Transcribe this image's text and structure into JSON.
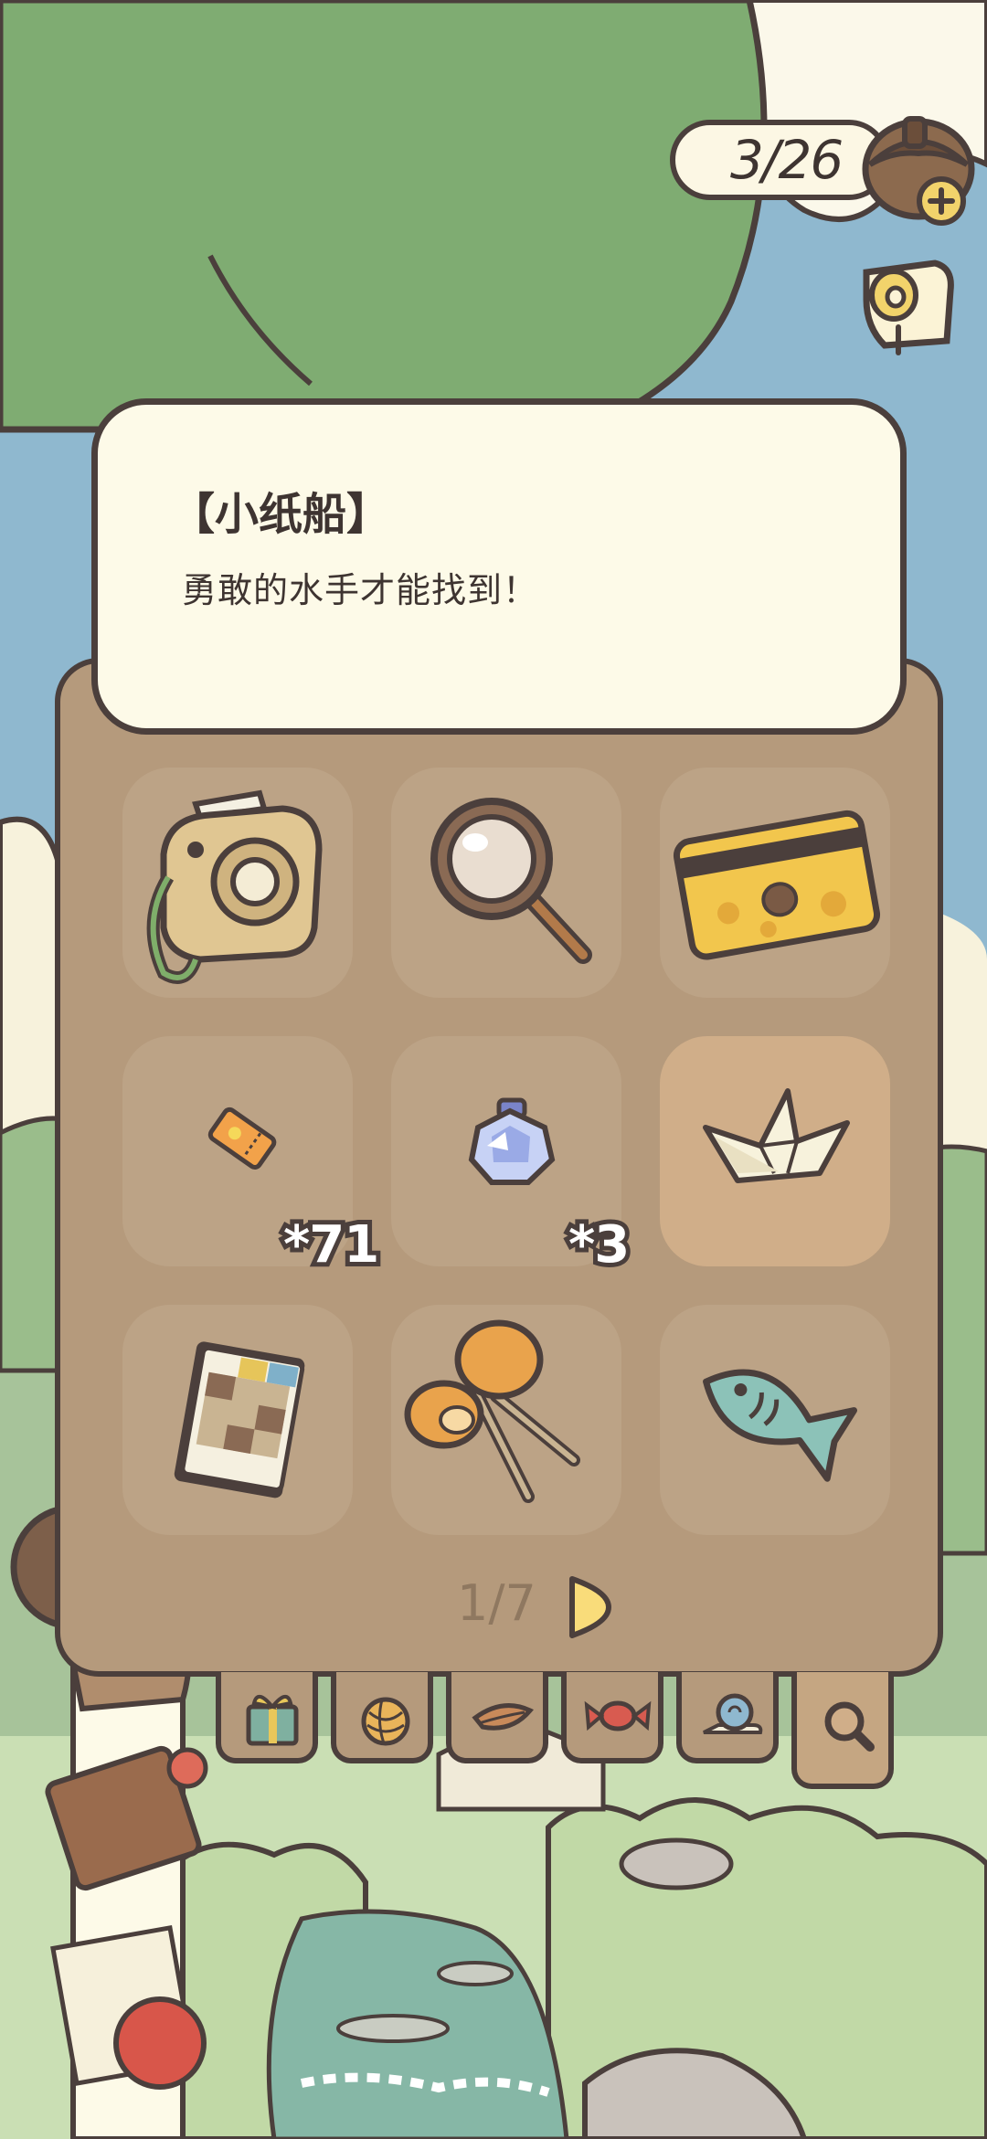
{
  "counter": {
    "value": "3/26"
  },
  "description": {
    "name": "【小纸船】",
    "text": "勇敢的水手才能找到！"
  },
  "inventory": {
    "page": "1/7",
    "slots": [
      {
        "icon": "camera-icon"
      },
      {
        "icon": "magnifying-glass-icon"
      },
      {
        "icon": "gold-card-icon"
      },
      {
        "icon": "ticket-icon",
        "qty": "*71"
      },
      {
        "icon": "crystal-icon",
        "qty": "*3"
      },
      {
        "icon": "paper-boat-icon",
        "selected": true
      },
      {
        "icon": "picture-book-icon"
      },
      {
        "icon": "castanets-icon"
      },
      {
        "icon": "fish-icon"
      }
    ]
  },
  "tabs": [
    {
      "icon": "gift-icon"
    },
    {
      "icon": "yarn-icon"
    },
    {
      "icon": "leaf-icon"
    },
    {
      "icon": "candy-icon"
    },
    {
      "icon": "snail-icon"
    },
    {
      "icon": "search-icon",
      "active": true
    }
  ],
  "colors": {
    "panel": "#b59a7c",
    "slot": "#bca386",
    "slot_selected": "#d0ae89",
    "outline": "#4b3f3c",
    "bubble": "#fdfae8"
  }
}
